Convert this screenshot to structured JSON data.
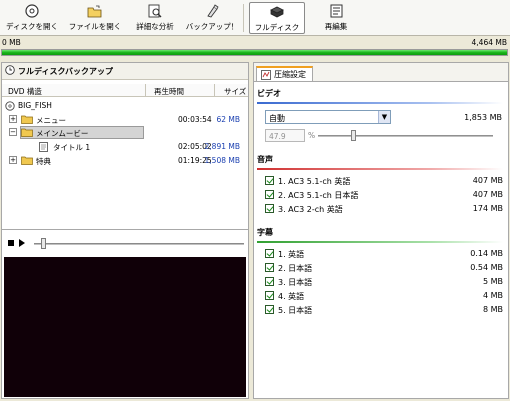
{
  "toolbar": {
    "buttons": [
      {
        "label": "ディスクを開く",
        "icon": "disc-icon"
      },
      {
        "label": "ファイルを開く",
        "icon": "folder-open-icon"
      },
      {
        "label": "詳細な分析",
        "icon": "analysis-icon"
      },
      {
        "label": "バックアップ！",
        "icon": "backup-icon"
      },
      {
        "label": "フルディスク",
        "icon": "full-disc-icon",
        "active": true
      },
      {
        "label": "再編集",
        "icon": "reauthor-icon"
      }
    ]
  },
  "capacity": {
    "left_label": "0 MB",
    "right_label": "4,464 MB",
    "fill_fraction": 1.0,
    "fill_color": "#19b419"
  },
  "left_panel": {
    "title": "フルディスクバックアップ",
    "columns": {
      "structure": "DVD 構造",
      "time": "再生時間",
      "size": "サイズ"
    },
    "tree": [
      {
        "name": "BIG_FISH",
        "time": "",
        "size": ""
      },
      {
        "name": "メニュー",
        "time": "00:03:54",
        "size": "62 MB"
      },
      {
        "name": "メインムービー",
        "time": "",
        "size": ""
      },
      {
        "name": "タイトル 1",
        "time": "02:05:02",
        "size": "2,891 MB"
      },
      {
        "name": "特典",
        "time": "01:19:25",
        "size": "1,508 MB"
      }
    ],
    "seek_position": 0.0
  },
  "right_panel": {
    "tab_label": "圧縮設定",
    "video": {
      "title": "ビデオ",
      "mode": "自動",
      "size": "1,853 MB",
      "percent_value": "47.9",
      "percent_unit": "%"
    },
    "audio": {
      "title": "音声",
      "items": [
        {
          "label": "1. AC3 5.1-ch 英語",
          "size": "407 MB",
          "checked": true
        },
        {
          "label": "2. AC3 5.1-ch 日本語",
          "size": "407 MB",
          "checked": true
        },
        {
          "label": "3. AC3 2-ch 英語",
          "size": "174 MB",
          "checked": true
        }
      ]
    },
    "subtitles": {
      "title": "字幕",
      "items": [
        {
          "label": "1. 英語",
          "size": "0.14 MB",
          "checked": true
        },
        {
          "label": "2. 日本語",
          "size": "0.54 MB",
          "checked": true
        },
        {
          "label": "3. 日本語",
          "size": "5 MB",
          "checked": true
        },
        {
          "label": "4. 英語",
          "size": "4 MB",
          "checked": true
        },
        {
          "label": "5. 日本語",
          "size": "8 MB",
          "checked": true
        }
      ]
    }
  }
}
